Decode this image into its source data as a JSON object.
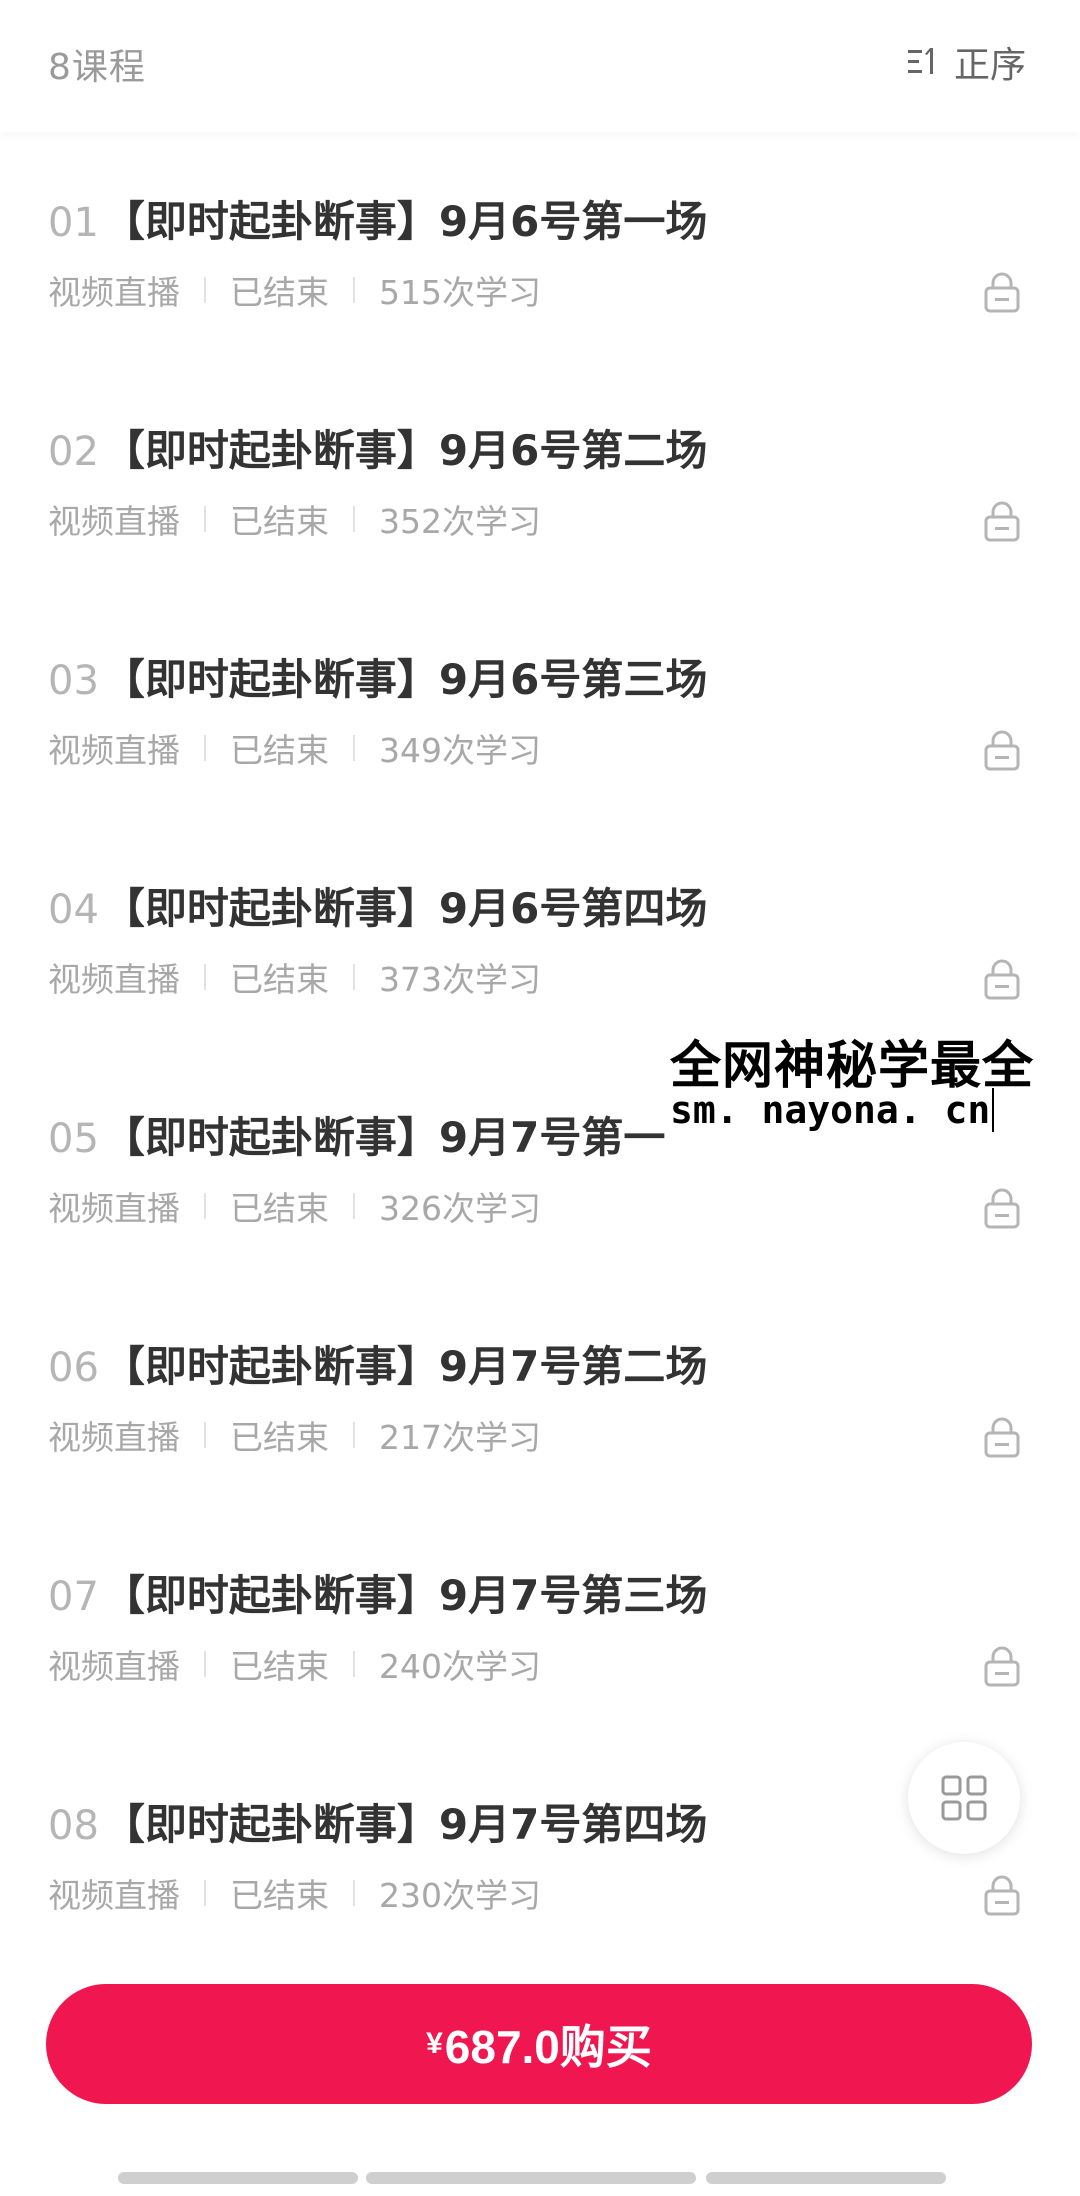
{
  "header": {
    "course_count": "8课程",
    "sort_label": "正序"
  },
  "lessons": [
    {
      "index": "01",
      "title": "【即时起卦断事】9月6号第一场",
      "type": "视频直播",
      "status": "已结束",
      "views": "515次学习"
    },
    {
      "index": "02",
      "title": "【即时起卦断事】9月6号第二场",
      "type": "视频直播",
      "status": "已结束",
      "views": "352次学习"
    },
    {
      "index": "03",
      "title": "【即时起卦断事】9月6号第三场",
      "type": "视频直播",
      "status": "已结束",
      "views": "349次学习"
    },
    {
      "index": "04",
      "title": "【即时起卦断事】9月6号第四场",
      "type": "视频直播",
      "status": "已结束",
      "views": "373次学习"
    },
    {
      "index": "05",
      "title": "【即时起卦断事】9月7号第一",
      "type": "视频直播",
      "status": "已结束",
      "views": "326次学习"
    },
    {
      "index": "06",
      "title": "【即时起卦断事】9月7号第二场",
      "type": "视频直播",
      "status": "已结束",
      "views": "217次学习"
    },
    {
      "index": "07",
      "title": "【即时起卦断事】9月7号第三场",
      "type": "视频直播",
      "status": "已结束",
      "views": "240次学习"
    },
    {
      "index": "08",
      "title": "【即时起卦断事】9月7号第四场",
      "type": "视频直播",
      "status": "已结束",
      "views": "230次学习"
    }
  ],
  "watermark": {
    "line1": "全网神秘学最全",
    "line2": "sm. nayona. cn"
  },
  "buy": {
    "currency": "¥",
    "label": "687.0购买"
  },
  "icons": {
    "sort": "sort-order-icon",
    "lock": "lock-icon",
    "grid": "grid-menu-icon"
  },
  "colors": {
    "accent": "#f0164f",
    "muted_text": "#a8a8a8",
    "title_text": "#333333"
  }
}
